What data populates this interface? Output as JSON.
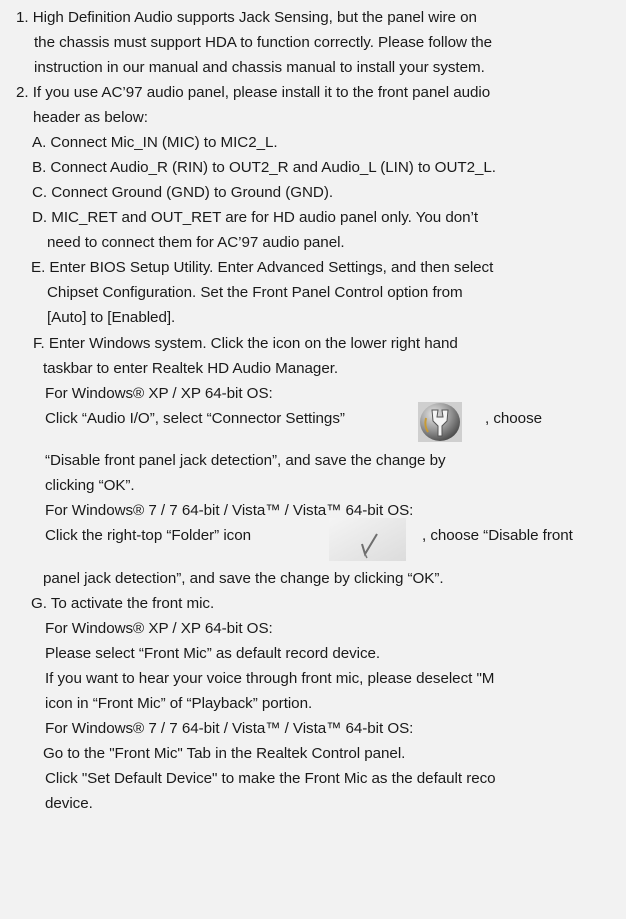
{
  "lines": {
    "l1": "1. High Definition Audio supports Jack Sensing, but the panel wire on",
    "l2": "the chassis must support HDA to function correctly. Please follow the",
    "l3": "instruction in our manual and chassis manual to install your system.",
    "l4": "2. If you use AC’97 audio panel, please install it to the front panel audio",
    "l5": "header as below:",
    "l6": "A. Connect Mic_IN (MIC) to MIC2_L.",
    "l7": "B. Connect Audio_R (RIN) to OUT2_R and Audio_L (LIN) to OUT2_L.",
    "l8": "C. Connect Ground (GND) to Ground (GND).",
    "l9": "D. MIC_RET and OUT_RET are for HD audio panel only. You don’t",
    "l10": "need to connect them for AC’97 audio panel.",
    "l11": "E. Enter BIOS Setup Utility. Enter Advanced Settings, and then select",
    "l12": "Chipset Configuration. Set the Front Panel Control option from",
    "l13": "[Auto] to [Enabled].",
    "l14": "F. Enter Windows system. Click the icon on the lower right hand",
    "l15": "taskbar to enter Realtek HD Audio Manager.",
    "l16": "For Windows® XP / XP 64-bit OS:",
    "l17a": "Click “Audio I/O”, select “Connector Settings”",
    "l17b": ", choose",
    "l18": "“Disable front panel jack detection”, and save the change by",
    "l19": "clicking “OK”.",
    "l20": "For Windows® 7 / 7 64-bit / Vista™ / Vista™ 64-bit OS:",
    "l21a": "Click the right-top “Folder” icon",
    "l21b": ", choose “Disable front",
    "l22": "panel jack detection”, and save the change by clicking “OK”.",
    "l23": "G. To activate the front mic.",
    "l24": "For Windows® XP / XP 64-bit OS:",
    "l25": "Please select “Front Mic” as default record device.",
    "l26": "If you want to hear your voice through front mic, please deselect \"M",
    "l27": "icon in “Front Mic” of “Playback” portion.",
    "l28": "For Windows® 7 / 7 64-bit / Vista™ / Vista™ 64-bit OS:",
    "l29": "Go to the \"Front Mic\" Tab in the Realtek Control panel.",
    "l30": "Click \"Set Default Device\" to make the Front Mic as the default reco",
    "l31": "device."
  },
  "icons": {
    "connector_settings": "connector-settings-wrench-icon",
    "folder": "folder-check-icon"
  }
}
